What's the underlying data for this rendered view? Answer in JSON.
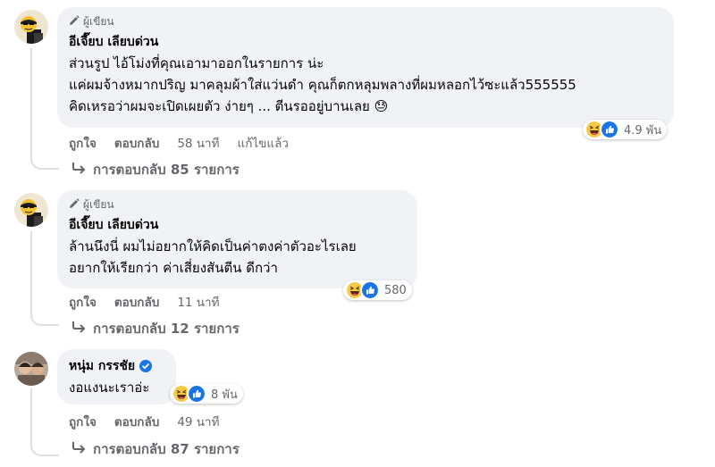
{
  "comments": [
    {
      "author_badge": "ผู้เขียน",
      "author_name": "อีเจี๊ยบ เลียบด่วน",
      "lines": [
        "ส่วนรูป ไอ้โม่งที่คุณเอามาออกในรายการ น่ะ",
        "แค่ผมจ้างหมากปริญ มาคลุมผ้าใส่แว่นดำ คุณก็ตกหลุมพลางที่ผมหลอกไว้ซะแล้ว555555",
        "คิดเหรอว่าผมจะเปิดเผยตัว ง่ายๆ ... ตีนรออยู่บานเลย 😓"
      ],
      "reaction_count": "4.9 พัน",
      "like_label": "ถูกใจ",
      "reply_label": "ตอบกลับ",
      "time": "58 นาที",
      "edited": "แก้ไขแล้ว",
      "replies_label": "การตอบกลับ 85 รายการ"
    },
    {
      "author_badge": "ผู้เขียน",
      "author_name": "อีเจี๊ยบ เลียบด่วน",
      "lines": [
        "ล้านนึงนี่ ผมไม่อยากให้คิดเป็นค่าตงค่าตัวอะไรเลย",
        "อยากให้เรียกว่า ค่าเสี่ยงสันตีน ดีกว่า"
      ],
      "reaction_count": "580",
      "like_label": "ถูกใจ",
      "reply_label": "ตอบกลับ",
      "time": "11 นาที",
      "replies_label": "การตอบกลับ 12 รายการ"
    },
    {
      "author_name": "หนุ่ม กรรชัย",
      "lines": [
        "งอแงนะเราอ่ะ"
      ],
      "reaction_count": "8 พัน",
      "like_label": "ถูกใจ",
      "reply_label": "ตอบกลับ",
      "time": "49 นาที",
      "replies_label": "การตอบกลับ 87 รายการ"
    }
  ],
  "colors": {
    "bubble": "#f0f2f5",
    "secondary_text": "#65676b",
    "like_blue": "#1b74e4",
    "haha_yellow": "#f7c947"
  },
  "icons": [
    "pencil-icon",
    "haha-reaction-icon",
    "like-reaction-icon",
    "reply-arrow-icon",
    "verified-badge-icon"
  ]
}
